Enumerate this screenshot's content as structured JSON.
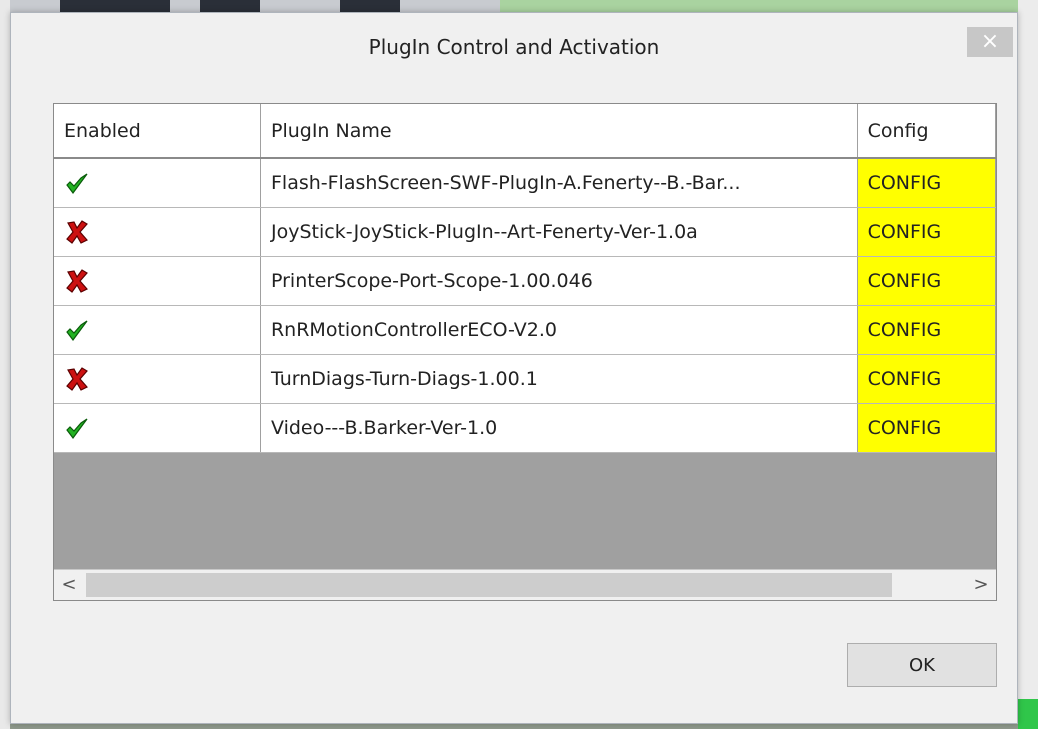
{
  "dialog": {
    "title": "PlugIn Control and Activation",
    "close_glyph": "×"
  },
  "grid": {
    "columns": [
      "Enabled",
      "PlugIn Name",
      "Config"
    ],
    "rows": [
      {
        "enabled": true,
        "name": "Flash-FlashScreen-SWF-PlugIn-A.Fenerty--B.-Bar...",
        "config": "CONFIG"
      },
      {
        "enabled": false,
        "name": "JoyStick-JoyStick-PlugIn--Art-Fenerty-Ver-1.0a",
        "config": "CONFIG"
      },
      {
        "enabled": false,
        "name": "PrinterScope-Port-Scope-1.00.046",
        "config": "CONFIG"
      },
      {
        "enabled": true,
        "name": "RnRMotionControllerECO-V2.0",
        "config": "CONFIG"
      },
      {
        "enabled": false,
        "name": "TurnDiags-Turn-Diags-1.00.1",
        "config": "CONFIG"
      },
      {
        "enabled": true,
        "name": "Video---B.Barker-Ver-1.0",
        "config": "CONFIG"
      }
    ]
  },
  "scrollbar": {
    "left_glyph": "<",
    "right_glyph": ">"
  },
  "buttons": {
    "ok_label": "OK"
  },
  "colors": {
    "config_bg": "#ffff00",
    "check_green": "#22b222",
    "cross_red": "#cc1111"
  }
}
